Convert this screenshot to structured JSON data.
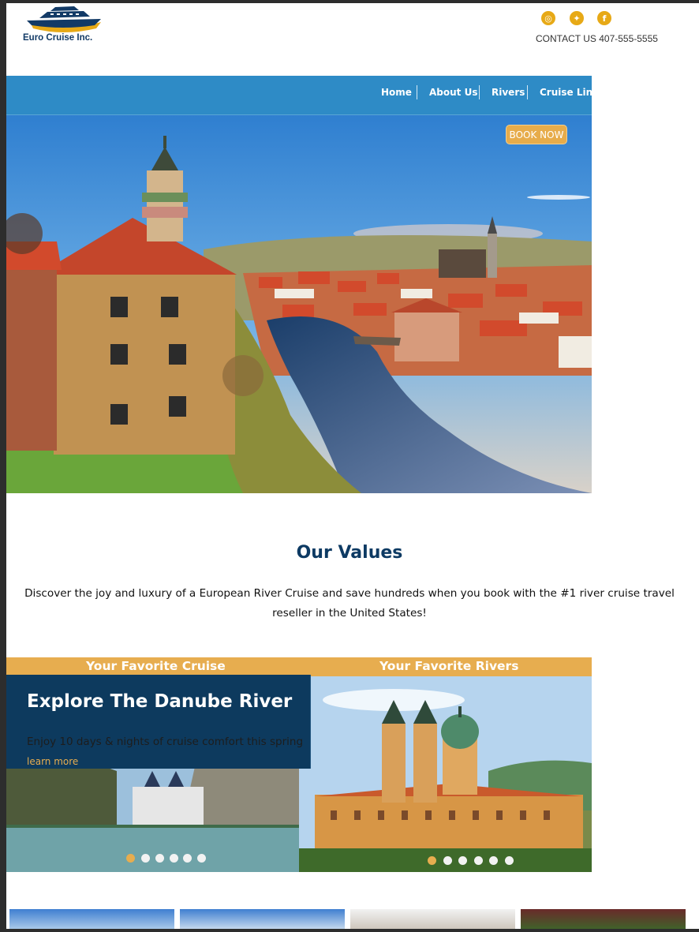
{
  "brand": {
    "name": "Euro Cruise Inc."
  },
  "header": {
    "contact": "CONTACT US 407-555-5555",
    "social": [
      {
        "name": "instagram",
        "glyph": "◎"
      },
      {
        "name": "twitter",
        "glyph": "✦"
      },
      {
        "name": "facebook",
        "glyph": "f"
      }
    ]
  },
  "nav": {
    "items": [
      {
        "label": "Home"
      },
      {
        "label": "About Us"
      },
      {
        "label": "Rivers"
      },
      {
        "label": "Cruise Lines"
      }
    ]
  },
  "hero": {
    "book_now": "BOOK NOW"
  },
  "values": {
    "title": "Our Values",
    "text": "Discover the joy and luxury of a European River Cruise and save hundreds when you book with the #1 river cruise travel reseller in the United States!"
  },
  "favorites": {
    "cruise_label": "Your Favorite Cruise",
    "rivers_label": "Your Favorite Rivers",
    "cruise_title": "Explore The Danube River",
    "cruise_text": "Enjoy 10 days & nights of cruise comfort this spring",
    "cruise_link": "learn more",
    "cruise_active_slide": 1,
    "rivers_active_slide": 1,
    "slide_count": 6
  },
  "colors": {
    "accent": "#e7ad4f",
    "nav_blue": "#2e8bc6",
    "navy": "#0d3a63"
  }
}
